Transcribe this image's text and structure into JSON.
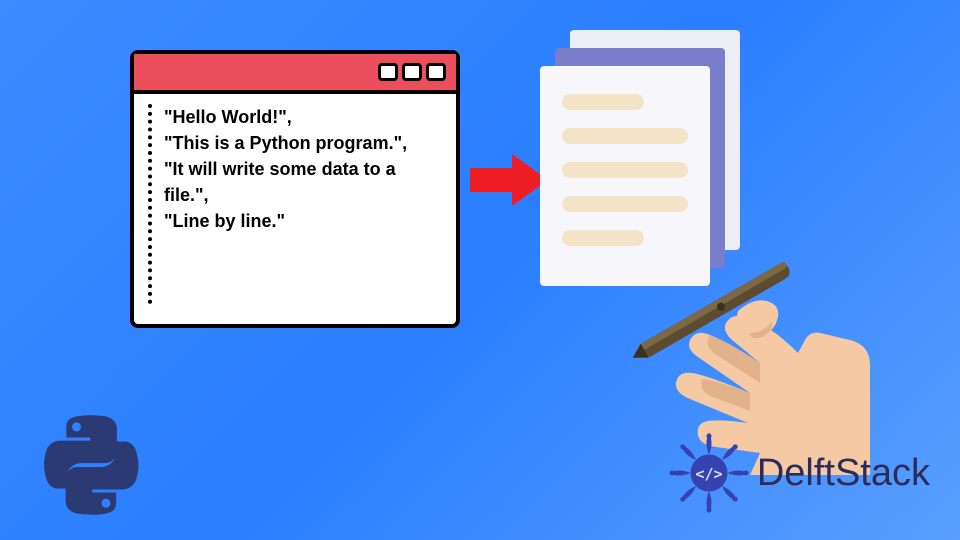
{
  "code_lines": [
    "\"Hello World!\",",
    "\"This is a Python program.\",",
    "\"It will write some data to a file.\",",
    "\"Line by line.\""
  ],
  "brand": "DelftStack",
  "icons": {
    "python": "python-logo",
    "brand_badge": "code-slash-badge",
    "arrow": "red-right-arrow",
    "hand": "hand-writing-pen",
    "papers": "paper-stack"
  },
  "colors": {
    "bg_gradient_start": "#3d8bff",
    "bg_gradient_end": "#5a9fff",
    "titlebar": "#ec4f5c",
    "arrow": "#ee1d23",
    "paper_mid": "#7a7dc9",
    "paper_line": "#f3e4c8",
    "brand_text": "#2d2b5a",
    "brand_badge": "#3542b0",
    "hand_skin": "#f4c9a3",
    "pen": "#5d4b30"
  }
}
